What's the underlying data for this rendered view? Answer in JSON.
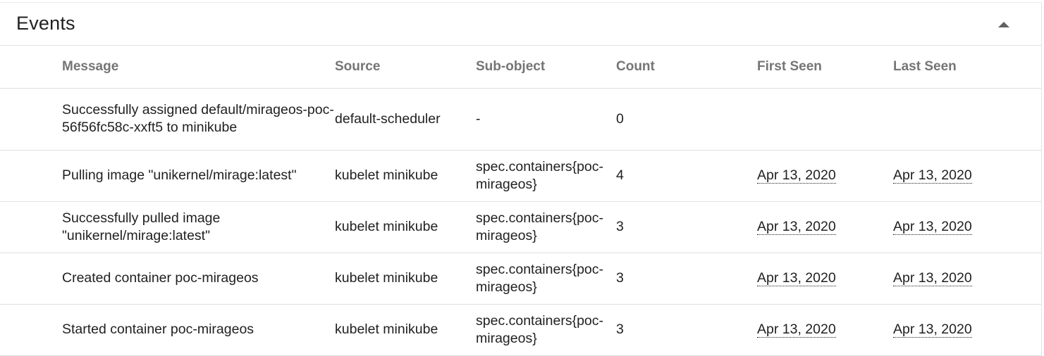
{
  "card": {
    "title": "Events",
    "collapse_icon": "arrow-drop-up-icon"
  },
  "table": {
    "columns": {
      "message": "Message",
      "source": "Source",
      "subobject": "Sub-object",
      "count": "Count",
      "first_seen": "First Seen",
      "last_seen": "Last Seen"
    },
    "rows": [
      {
        "message": "Successfully assigned default/mirageos-poc-56f56fc58c-xxft5 to minikube",
        "source": "default-scheduler",
        "subobject": "-",
        "count": "0",
        "first_seen": "",
        "last_seen": ""
      },
      {
        "message": "Pulling image \"unikernel/mirage:latest\"",
        "source": "kubelet minikube",
        "subobject": "spec.containers{poc-mirageos}",
        "count": "4",
        "first_seen": "Apr 13, 2020",
        "last_seen": "Apr 13, 2020"
      },
      {
        "message": "Successfully pulled image \"unikernel/mirage:latest\"",
        "source": "kubelet minikube",
        "subobject": "spec.containers{poc-mirageos}",
        "count": "3",
        "first_seen": "Apr 13, 2020",
        "last_seen": "Apr 13, 2020"
      },
      {
        "message": "Created container poc-mirageos",
        "source": "kubelet minikube",
        "subobject": "spec.containers{poc-mirageos}",
        "count": "3",
        "first_seen": "Apr 13, 2020",
        "last_seen": "Apr 13, 2020"
      },
      {
        "message": "Started container poc-mirageos",
        "source": "kubelet minikube",
        "subobject": "spec.containers{poc-mirageos}",
        "count": "3",
        "first_seen": "Apr 13, 2020",
        "last_seen": "Apr 13, 2020"
      }
    ]
  }
}
